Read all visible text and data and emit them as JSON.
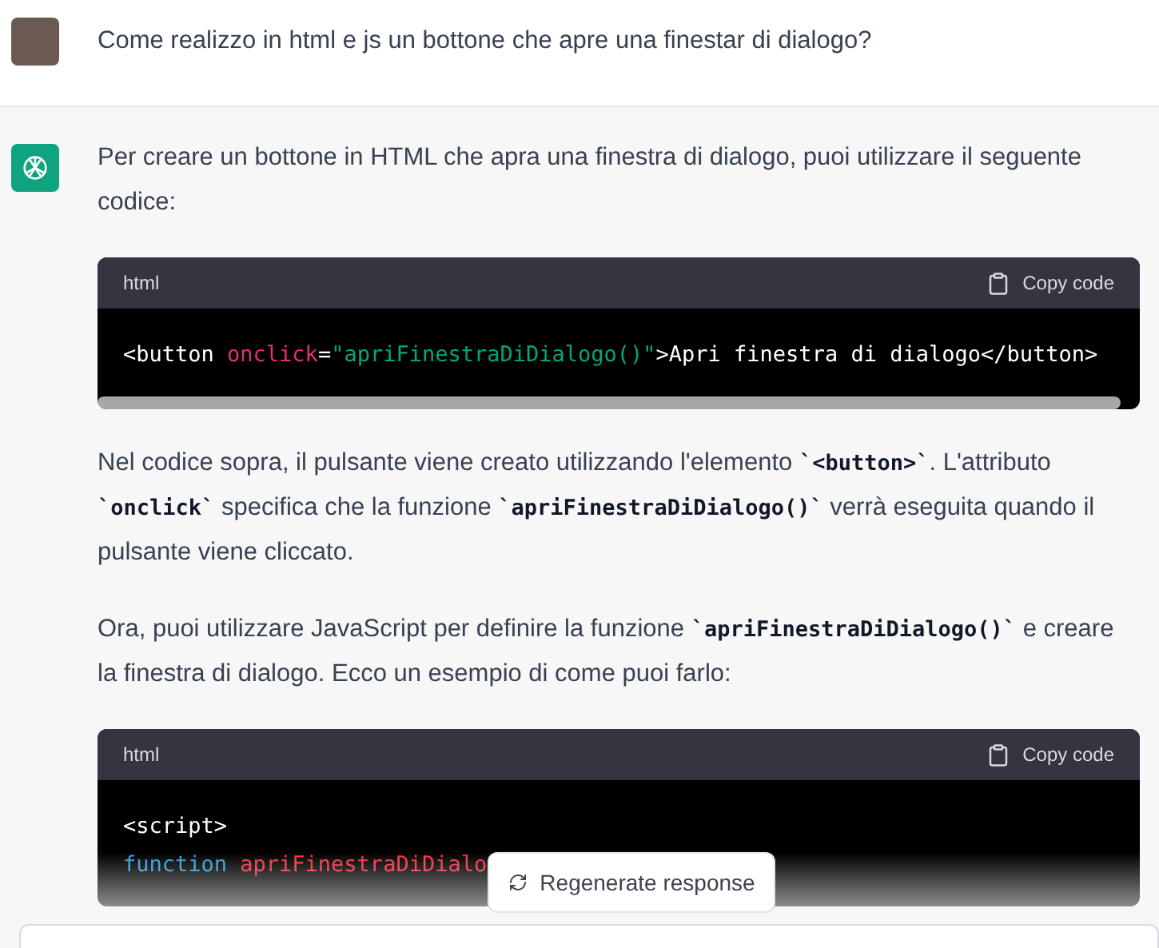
{
  "user_message": {
    "text": "Come realizzo in html e js un bottone che apre una finestar di dialogo?"
  },
  "assistant_message": {
    "blocks": [
      {
        "kind": "paragraph",
        "segments": [
          {
            "kind": "text",
            "text": "Per creare un bottone in HTML che apra una finestra di dialogo, puoi utilizzare il seguente codice:"
          }
        ]
      },
      {
        "kind": "code",
        "language": "html",
        "copy_label": "Copy code",
        "lines": [
          [
            {
              "kind": "plain",
              "text": "<button "
            },
            {
              "kind": "attr",
              "text": "onclick"
            },
            {
              "kind": "plain",
              "text": "="
            },
            {
              "kind": "string",
              "text": "\"apriFinestraDiDialogo()\""
            },
            {
              "kind": "plain",
              "text": ">Apri finestra di dialogo</button>"
            }
          ]
        ]
      },
      {
        "kind": "paragraph",
        "segments": [
          {
            "kind": "text",
            "text": "Nel codice sopra, il pulsante viene creato utilizzando l'elemento "
          },
          {
            "kind": "code",
            "text": "`<button>`"
          },
          {
            "kind": "text",
            "text": ". L'attributo "
          },
          {
            "kind": "code",
            "text": "`onclick`"
          },
          {
            "kind": "text",
            "text": " specifica che la funzione "
          },
          {
            "kind": "code",
            "text": "`apriFinestraDiDialogo()`"
          },
          {
            "kind": "text",
            "text": " verrà eseguita quando il pulsante viene cliccato."
          }
        ]
      },
      {
        "kind": "paragraph",
        "segments": [
          {
            "kind": "text",
            "text": "Ora, puoi utilizzare JavaScript per definire la funzione "
          },
          {
            "kind": "code",
            "text": "`apriFinestraDiDialogo()`"
          },
          {
            "kind": "text",
            "text": " e creare la finestra di dialogo. Ecco un esempio di come puoi farlo:"
          }
        ]
      },
      {
        "kind": "code",
        "language": "html",
        "copy_label": "Copy code",
        "lines": [
          [
            {
              "kind": "plain",
              "text": "<script>"
            }
          ],
          [
            {
              "kind": "keyword",
              "text": "function"
            },
            {
              "kind": "name",
              "text": " apriFinestraDiDialo"
            }
          ]
        ]
      }
    ]
  },
  "regenerate_button": {
    "label": "Regenerate response"
  }
}
